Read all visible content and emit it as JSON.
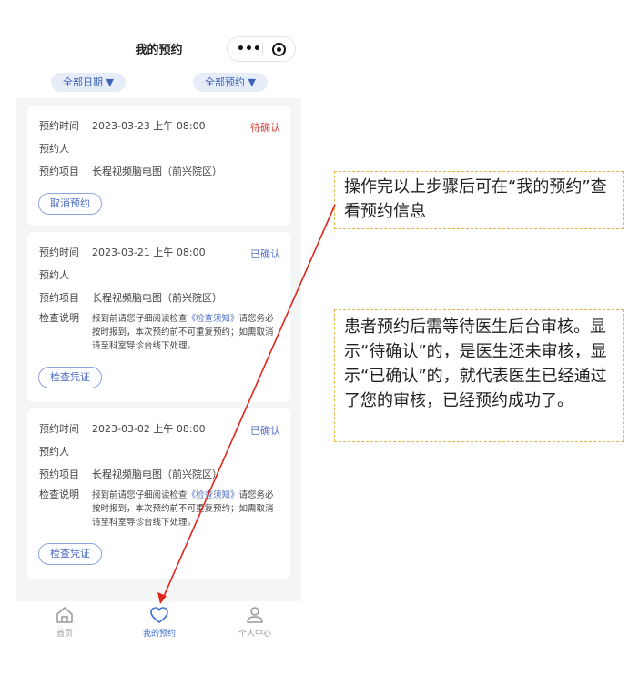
{
  "navbar": {
    "title": "我的预约",
    "menu_glyph": "•••"
  },
  "filters": {
    "date": "全部日期 ▼",
    "status": "全部预约 ▼"
  },
  "labels": {
    "time": "预约时间",
    "person": "预约人",
    "item": "预约项目",
    "note": "检查说明"
  },
  "cards": [
    {
      "time": "2023-03-23 上午 08:00",
      "status": "待确认",
      "item": "长程视频脑电图（前兴院区）",
      "button": "取消预约"
    },
    {
      "time": "2023-03-21 上午 08:00",
      "status": "已确认",
      "item": "长程视频脑电图（前兴院区）",
      "note_pre": "报到前请您仔细阅读检查",
      "note_link": "《检查须知》",
      "note_post": "请您务必按时报到，本次预约前不可重复预约；如需取消请至科室导诊台线下处理。",
      "button": "检查凭证"
    },
    {
      "time": "2023-03-02 上午 08:00",
      "status": "已确认",
      "item": "长程视频脑电图（前兴院区）",
      "note_pre": "报到前请您仔细阅读检查",
      "note_link": "《检查须知》",
      "note_post": "请您务必按时报到，本次预约前不可重复预约；如需取消请至科室导诊台线下处理。",
      "button": "检查凭证"
    }
  ],
  "tabbar": {
    "home": "首页",
    "appointments": "我的预约",
    "me": "个人中心"
  },
  "callouts": {
    "first": "操作完以上步骤后可在“我的预约”查看预约信息",
    "second": "患者预约后需等待医生后台审核。显示“待确认”的，是医生还未审核，显示“已确认”的，就代表医生已经通过了您的审核，已经预约成功了。"
  },
  "colors": {
    "accent": "#3d73d6",
    "pending": "#d6403d",
    "confirmed": "#5872c7",
    "annotation_arrow": "#e0261c",
    "callout_border": "#e2b64a"
  }
}
